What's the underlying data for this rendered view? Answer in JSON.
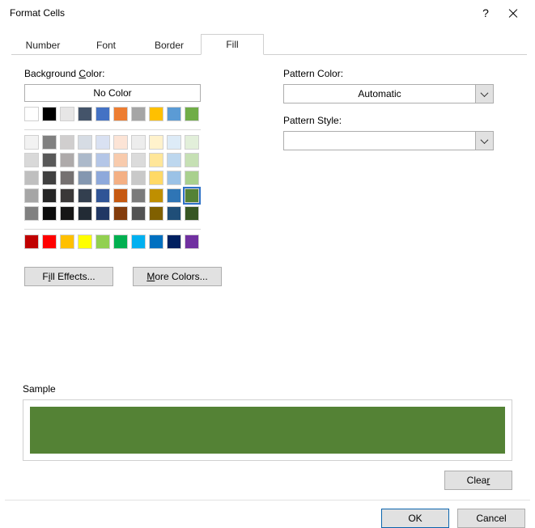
{
  "title": "Format Cells",
  "tabs": {
    "number": "Number",
    "font": "Font",
    "border": "Border",
    "fill": "Fill"
  },
  "labels": {
    "bg": "Background Color:",
    "bg_u": "C",
    "no_color": "No Color",
    "pattern_color": "Pattern Color:",
    "pattern_color_u": "A",
    "pattern_color_val": "Automatic",
    "pattern_style": "Pattern Style:",
    "pattern_style_u": "P",
    "sample": "Sample",
    "fill_effects": "Fill Effects...",
    "fill_effects_u": "I",
    "more_colors": "More Colors...",
    "more_colors_u": "M",
    "clear": "Clear",
    "clear_u": "r",
    "ok": "OK",
    "cancel": "Cancel"
  },
  "selected_color": "#548235",
  "theme_row": [
    "#ffffff",
    "#000000",
    "#e7e6e6",
    "#44546a",
    "#4472c4",
    "#ed7d31",
    "#a5a5a5",
    "#ffc000",
    "#5b9bd5",
    "#70ad47"
  ],
  "tints": [
    [
      "#f2f2f2",
      "#808080",
      "#d0cece",
      "#d6dce4",
      "#d9e1f2",
      "#fce4d6",
      "#ededed",
      "#fff2cc",
      "#ddebf7",
      "#e2efda"
    ],
    [
      "#d9d9d9",
      "#595959",
      "#aeaaaa",
      "#acb9ca",
      "#b4c6e7",
      "#f8cbad",
      "#dbdbdb",
      "#ffe699",
      "#bdd7ee",
      "#c6e0b4"
    ],
    [
      "#bfbfbf",
      "#404040",
      "#757171",
      "#8497b0",
      "#8ea9db",
      "#f4b084",
      "#c9c9c9",
      "#ffd966",
      "#9bc2e6",
      "#a9d08e"
    ],
    [
      "#a6a6a6",
      "#262626",
      "#3a3838",
      "#333f4f",
      "#305496",
      "#c65911",
      "#7b7b7b",
      "#bf8f00",
      "#2f75b5",
      "#548235"
    ],
    [
      "#808080",
      "#0d0d0d",
      "#161616",
      "#222b35",
      "#203764",
      "#833c0c",
      "#525252",
      "#806000",
      "#1f4e78",
      "#375623"
    ]
  ],
  "standard": [
    "#c00000",
    "#ff0000",
    "#ffc000",
    "#ffff00",
    "#92d050",
    "#00b050",
    "#00b0f0",
    "#0070c0",
    "#002060",
    "#7030a0"
  ]
}
